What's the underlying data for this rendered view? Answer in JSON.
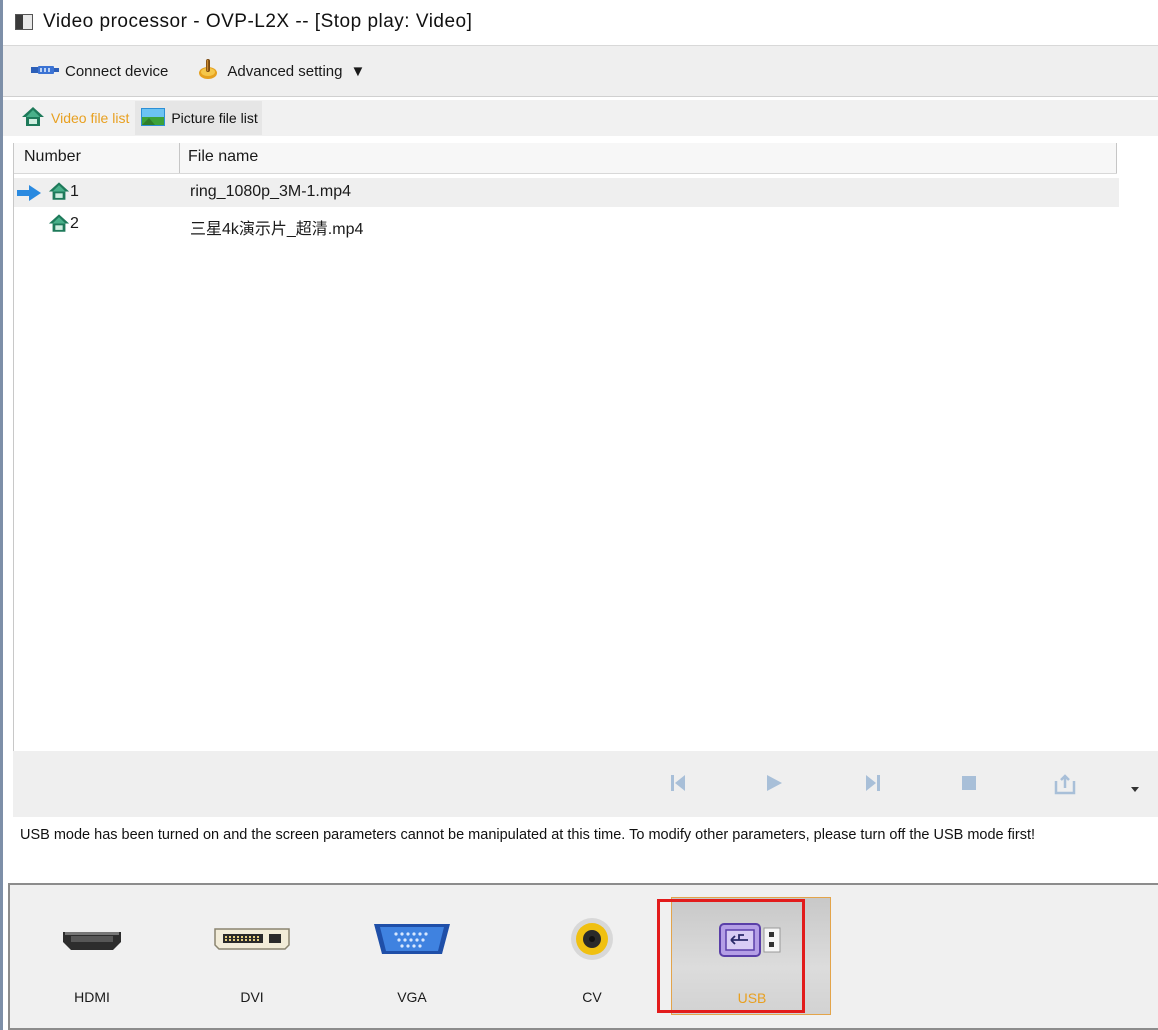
{
  "window": {
    "title": "Video processor  -  OVP-L2X  --  [Stop play: Video]"
  },
  "toolbar": {
    "connect_label": "Connect device",
    "advanced_label": "Advanced setting"
  },
  "tabs": [
    {
      "label": "Video file list",
      "active": true
    },
    {
      "label": "Picture file list",
      "active": false
    }
  ],
  "table": {
    "columns": [
      "Number",
      "File name"
    ],
    "rows": [
      {
        "number": "1",
        "file": "ring_1080p_3M-1.mp4",
        "current": true
      },
      {
        "number": "2",
        "file": "三星4k演示片_超清.mp4",
        "current": false
      }
    ]
  },
  "player": {
    "buttons": [
      "previous-icon",
      "play-icon",
      "next-icon",
      "stop-icon",
      "export-icon",
      "overflow-caret-icon"
    ]
  },
  "message": "USB mode has been turned on and the screen parameters cannot be manipulated at this time. To modify other parameters, please turn off the USB mode first!",
  "sources": [
    {
      "label": "HDMI",
      "icon": "hdmi-port-icon",
      "active": false
    },
    {
      "label": "DVI",
      "icon": "dvi-port-icon",
      "active": false
    },
    {
      "label": "VGA",
      "icon": "vga-port-icon",
      "active": false
    },
    {
      "label": "CV",
      "icon": "composite-video-icon",
      "active": false
    },
    {
      "label": "USB",
      "icon": "usb-drive-icon",
      "active": true
    }
  ],
  "colors": {
    "active_text": "#e8a020",
    "highlight_box": "#e21b1b",
    "arrow_blue": "#2a8ae0"
  }
}
